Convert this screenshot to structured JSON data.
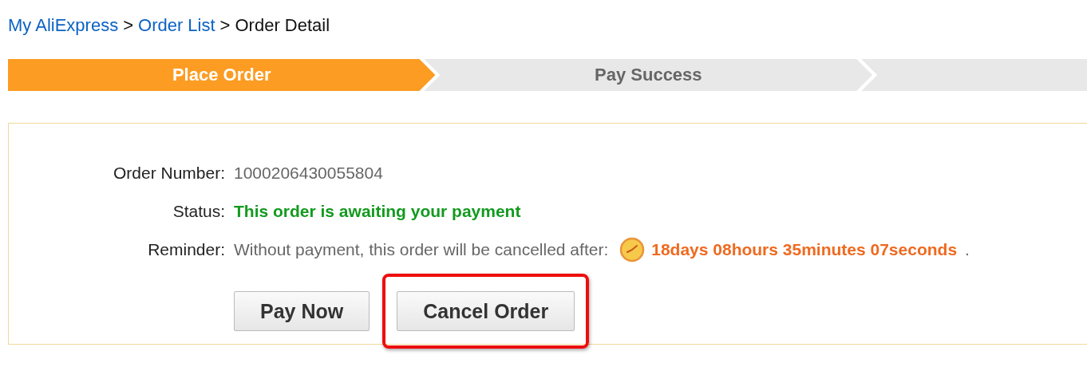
{
  "breadcrumb": [
    {
      "label": "My AliExpress",
      "kind": "link"
    },
    {
      "label": ">",
      "kind": "separator"
    },
    {
      "label": "Order List",
      "kind": "link"
    },
    {
      "label": ">",
      "kind": "separator"
    },
    {
      "label": "Order Detail",
      "kind": "current"
    }
  ],
  "steps": [
    {
      "label": "Place Order",
      "selected": true
    },
    {
      "label": "Pay Success",
      "selected": false
    }
  ],
  "order": {
    "fields": [
      {
        "label": "Order Number:",
        "value": "1000206430055804",
        "kind": "plain"
      },
      {
        "label": "Status:",
        "value": "This order is awaiting your payment",
        "kind": "status"
      },
      {
        "label": "Reminder:",
        "value": "Without payment, this order will be cancelled after:",
        "countdown": "18days 08hours 35minutes 07seconds",
        "end": ".",
        "kind": "countdown"
      }
    ],
    "buttons": [
      {
        "label": "Pay Now",
        "highlighted": false
      },
      {
        "label": "Cancel Order",
        "highlighted": true
      }
    ]
  }
}
